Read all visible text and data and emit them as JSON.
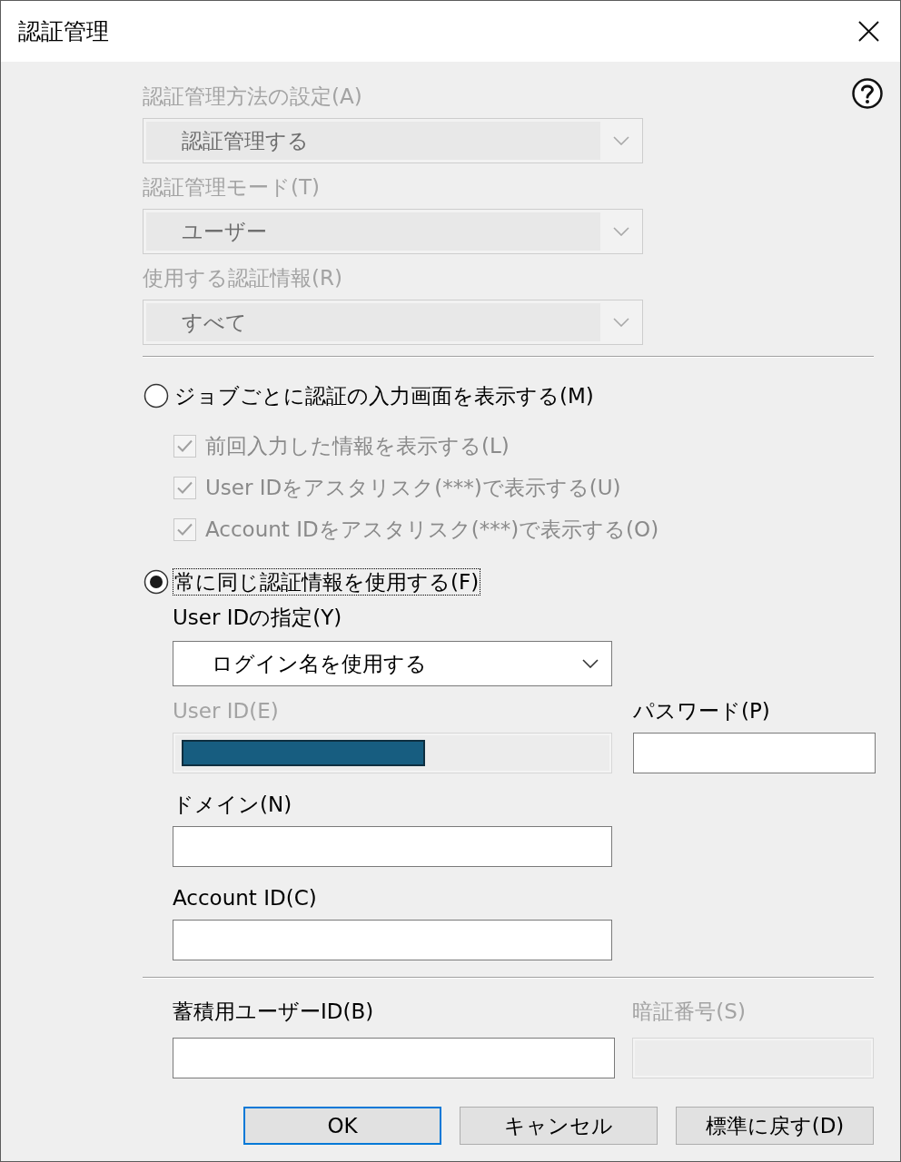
{
  "window": {
    "title": "認証管理"
  },
  "settings": [
    {
      "label": "認証管理方法の設定(A)",
      "value": "認証管理する",
      "disabled": true
    },
    {
      "label": "認証管理モード(T)",
      "value": "ユーザー",
      "disabled": true
    },
    {
      "label": "使用する認証情報(R)",
      "value": "すべて",
      "disabled": true
    }
  ],
  "radio_options": [
    {
      "label": "ジョブごとに認証の入力画面を表示する(M)",
      "selected": false,
      "focused": false,
      "sub_options": [
        {
          "label": "前回入力した情報を表示する(L)",
          "checked": true,
          "disabled": true
        },
        {
          "label": "User IDをアスタリスク(***)で表示する(U)",
          "checked": true,
          "disabled": true
        },
        {
          "label": "Account IDをアスタリスク(***)で表示する(O)",
          "checked": true,
          "disabled": true
        }
      ]
    },
    {
      "label": "常に同じ認証情報を使用する(F)",
      "selected": true,
      "focused": true
    }
  ],
  "credentials": {
    "user_id_source": {
      "label": "User IDの指定(Y)",
      "value": "ログイン名を使用する",
      "disabled": false
    },
    "rows": [
      {
        "fields": [
          {
            "label": "User ID(E)",
            "disabled": true,
            "redacted": true
          },
          {
            "label": "パスワード(P)",
            "disabled": false
          }
        ]
      },
      {
        "fields": [
          {
            "label": "ドメイン(N)",
            "disabled": false
          }
        ]
      },
      {
        "fields": [
          {
            "label": "Account ID(C)",
            "disabled": false
          }
        ]
      }
    ]
  },
  "storage": [
    {
      "label": "蓄積用ユーザーID(B)",
      "disabled": false
    },
    {
      "label": "暗証番号(S)",
      "disabled": true
    }
  ],
  "buttons": [
    {
      "label": "OK",
      "default": true
    },
    {
      "label": "キャンセル",
      "default": false
    },
    {
      "label": "標準に戻す(D)",
      "default": false
    }
  ]
}
